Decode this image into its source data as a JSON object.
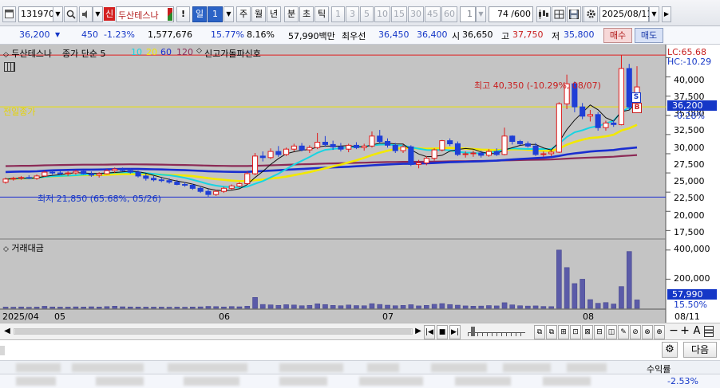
{
  "toolbar": {
    "stock_code": "131970",
    "badge": "신",
    "stock_name": "두산테스나",
    "exclaim": "!",
    "period_selected": "일",
    "period_selected_num": "1",
    "periods": [
      "주",
      "월",
      "년",
      "분",
      "초",
      "틱"
    ],
    "minute_options": [
      "1",
      "3",
      "5",
      "10",
      "15",
      "30",
      "45",
      "60"
    ],
    "custom_value": "1",
    "display_count": "74",
    "display_total": "/600",
    "date": "2025/08/11"
  },
  "quote": {
    "price": "36,200",
    "change": "450",
    "change_pct": "-1.23%",
    "volume": "1,577,676",
    "turnover_pct": "15.77%",
    "ratio_pct": "8.16%",
    "amount": "57,990백만",
    "best_label": "최우선",
    "best_ask": "36,450",
    "best_bid": "36,400",
    "open_label": "시",
    "open": "36,650",
    "high_label": "고",
    "high": "37,750",
    "low_label": "저",
    "low": "35,800",
    "buy_label": "매수",
    "sell_label": "매도"
  },
  "legend": {
    "name": "두산테스나",
    "ma_label": "종가 단순 5",
    "ma10": "10",
    "ma20": "20",
    "ma60": "60",
    "ma120": "120",
    "signal": "신고가돌파신호",
    "lc": "LC:65.68",
    "hc": "HC:-10.29"
  },
  "annotations": {
    "high": "최고 40,350 (-10.29%, 08/07)",
    "low": "최저 21,850 (65.68%, 05/26)",
    "prev_close": "전일종가",
    "marker_s": "S",
    "marker_b": "B"
  },
  "price_axis": {
    "labels": [
      "40,000",
      "37,500",
      "35,000",
      "32,500",
      "30,000",
      "27,500",
      "25,000",
      "22,500",
      "20,000",
      "17,500"
    ],
    "current": "36,200",
    "current_pct": "-0.28%"
  },
  "volume_panel": {
    "title": "거래대금",
    "labels": [
      "400,000",
      "200,000"
    ],
    "current": "57,990",
    "current_pct": "15.50%"
  },
  "date_axis": [
    "2025/04",
    "05",
    "06",
    "07",
    "08"
  ],
  "date_right": "08/11",
  "bottom": {
    "next_label": "다음",
    "return_label": "수익률",
    "return_value": "-2.53%"
  },
  "chart_data": {
    "type": "candlestick",
    "ylim": [
      16500,
      41500
    ],
    "volume_ylim": [
      0,
      470000
    ],
    "ohlc": [
      [
        23800,
        24400,
        23600,
        24200
      ],
      [
        24200,
        24500,
        24000,
        24300
      ],
      [
        24300,
        24600,
        24100,
        24400
      ],
      [
        24400,
        24700,
        24200,
        24300
      ],
      [
        24300,
        24800,
        24100,
        24600
      ],
      [
        24600,
        25300,
        24500,
        25100
      ],
      [
        25100,
        25400,
        24800,
        25000
      ],
      [
        25000,
        25300,
        24700,
        24900
      ],
      [
        24900,
        25200,
        24600,
        25000
      ],
      [
        25000,
        25400,
        24800,
        25200
      ],
      [
        25200,
        25300,
        24800,
        24900
      ],
      [
        24900,
        25200,
        24500,
        24700
      ],
      [
        24700,
        25100,
        24400,
        24900
      ],
      [
        24900,
        25500,
        24800,
        25300
      ],
      [
        25300,
        25700,
        25000,
        25500
      ],
      [
        25500,
        25700,
        25200,
        25300
      ],
      [
        25300,
        25600,
        24900,
        25100
      ],
      [
        25100,
        25300,
        24400,
        24600
      ],
      [
        24600,
        24900,
        24000,
        24300
      ],
      [
        24300,
        24600,
        23900,
        24100
      ],
      [
        24100,
        24400,
        23800,
        24000
      ],
      [
        24000,
        24300,
        23600,
        23800
      ],
      [
        23800,
        24100,
        23400,
        23500
      ],
      [
        23500,
        23800,
        23200,
        23400
      ],
      [
        23400,
        23600,
        22800,
        23000
      ],
      [
        23000,
        23300,
        22400,
        22600
      ],
      [
        22600,
        22900,
        21850,
        22200
      ],
      [
        22200,
        22800,
        22000,
        22600
      ],
      [
        22600,
        23200,
        22400,
        23000
      ],
      [
        23000,
        23500,
        22800,
        23300
      ],
      [
        23300,
        23800,
        23100,
        23600
      ],
      [
        23600,
        25200,
        23500,
        24900
      ],
      [
        24900,
        27600,
        24700,
        27200
      ],
      [
        27200,
        27800,
        26500,
        27000
      ],
      [
        27000,
        28200,
        26800,
        27800
      ],
      [
        27800,
        28500,
        27100,
        27400
      ],
      [
        27400,
        28300,
        27200,
        28100
      ],
      [
        28100,
        28800,
        27800,
        28500
      ],
      [
        28500,
        28900,
        27800,
        28000
      ],
      [
        28000,
        28600,
        27600,
        28300
      ],
      [
        28300,
        30200,
        28100,
        29000
      ],
      [
        29000,
        29800,
        28400,
        28700
      ],
      [
        28700,
        29200,
        28000,
        28400
      ],
      [
        28400,
        28900,
        27800,
        28100
      ],
      [
        28100,
        28800,
        27700,
        28600
      ],
      [
        28600,
        29000,
        28100,
        28300
      ],
      [
        28300,
        28800,
        27900,
        28500
      ],
      [
        28500,
        30400,
        28300,
        29800
      ],
      [
        29800,
        30600,
        28900,
        29100
      ],
      [
        29100,
        29500,
        28300,
        28600
      ],
      [
        28600,
        28900,
        27600,
        27900
      ],
      [
        27900,
        28700,
        27600,
        28400
      ],
      [
        28400,
        28600,
        25900,
        26100
      ],
      [
        26100,
        26700,
        25600,
        26300
      ],
      [
        26300,
        27200,
        26000,
        26900
      ],
      [
        26900,
        28200,
        26600,
        28000
      ],
      [
        28000,
        29300,
        27800,
        29200
      ],
      [
        29200,
        29500,
        28500,
        28800
      ],
      [
        28800,
        29100,
        27200,
        27400
      ],
      [
        27400,
        27800,
        27000,
        27500
      ],
      [
        27500,
        27900,
        27100,
        27600
      ],
      [
        27600,
        27900,
        27000,
        27300
      ],
      [
        27300,
        28100,
        27100,
        27800
      ],
      [
        27800,
        28200,
        27200,
        27400
      ],
      [
        27400,
        30900,
        27300,
        29800
      ],
      [
        29800,
        29900,
        28700,
        29100
      ],
      [
        29100,
        29300,
        28600,
        28800
      ],
      [
        28800,
        29100,
        28300,
        28500
      ],
      [
        28500,
        28900,
        27200,
        27400
      ],
      [
        27400,
        27800,
        27100,
        27500
      ],
      [
        27500,
        27900,
        27200,
        27700
      ],
      [
        27700,
        34200,
        27600,
        34000
      ],
      [
        34000,
        37800,
        33300,
        36600
      ],
      [
        36600,
        36900,
        32900,
        33600
      ],
      [
        33600,
        34100,
        32000,
        32400
      ],
      [
        32400,
        33200,
        31700,
        32600
      ],
      [
        32600,
        32900,
        30500,
        30900
      ],
      [
        30900,
        31800,
        30500,
        31500
      ],
      [
        31500,
        31900,
        31000,
        31300
      ],
      [
        31300,
        40350,
        31200,
        38600
      ],
      [
        38600,
        39200,
        33200,
        33600
      ],
      [
        33600,
        38900,
        33500,
        36200
      ]
    ],
    "volume": [
      9000,
      8000,
      10000,
      7500,
      9000,
      14000,
      10000,
      9000,
      9000,
      10500,
      9500,
      11000,
      9500,
      12000,
      14500,
      11000,
      10000,
      9500,
      8500,
      8500,
      9000,
      8000,
      8500,
      8000,
      9500,
      10500,
      13500,
      12000,
      10000,
      12500,
      11000,
      15000,
      75000,
      27000,
      24000,
      21000,
      25000,
      23000,
      18000,
      21000,
      31000,
      26000,
      20000,
      18000,
      23000,
      19000,
      18000,
      32000,
      27000,
      22000,
      18000,
      20000,
      25000,
      17000,
      20000,
      28000,
      33000,
      26000,
      22000,
      17000,
      15000,
      16000,
      19000,
      17000,
      39000,
      24000,
      18000,
      16000,
      17000,
      13000,
      12000,
      400000,
      280000,
      170000,
      200000,
      60000,
      35000,
      40000,
      30000,
      150000,
      390000,
      57990
    ]
  }
}
